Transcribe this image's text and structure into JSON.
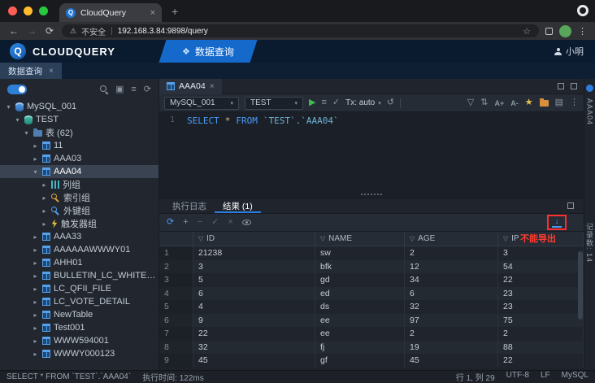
{
  "colors": {
    "accent": "#2e7de0",
    "nav_blue": "#1569cb",
    "run_green": "#3fb950",
    "star_yellow": "#e8c14b",
    "folder_orange": "#d98f3c",
    "annotation_red": "#ff3b30"
  },
  "icons": {
    "close": "×",
    "plus": "+",
    "minus": "−",
    "back": "←",
    "forward": "→",
    "reload": "⟳",
    "refresh": "⟳",
    "warning": "⚠",
    "star_outline": "☆",
    "star": "★",
    "menu_dots": "⋮",
    "nav_glyph": "❖",
    "caret": "▾",
    "arrow_down": "▾",
    "arrow_right": "▸",
    "filter": "▽",
    "play": "▶",
    "check": "✓",
    "undo": "↺",
    "sort": "⇅",
    "lines": "≡",
    "grid": "▤",
    "box": "▣",
    "font_plus": "A+",
    "font_minus": "A-",
    "download": "↓",
    "x": "×"
  },
  "browser": {
    "tab_title": "CloudQuery",
    "favicon_letter": "Q",
    "security": "不安全",
    "divider": "|",
    "url": "192.168.3.84:9898/query"
  },
  "header": {
    "brand": "CLOUDQUERY",
    "logo_letter": "Q",
    "nav_query": "数据查询",
    "user": "小明"
  },
  "workspace": {
    "tab": "数据查询"
  },
  "sidebar": {
    "tree": [
      {
        "label": "MySQL_001",
        "depth": 0,
        "icon": "db",
        "arrow": "down",
        "selected": false
      },
      {
        "label": "TEST",
        "depth": 1,
        "icon": "schema",
        "arrow": "down",
        "selected": false
      },
      {
        "label": "表 (62)",
        "depth": 2,
        "icon": "folder",
        "arrow": "down",
        "selected": false
      },
      {
        "label": "11",
        "depth": 3,
        "icon": "table",
        "arrow": "right",
        "selected": false
      },
      {
        "label": "AAA03",
        "depth": 3,
        "icon": "table",
        "arrow": "right",
        "selected": false
      },
      {
        "label": "AAA04",
        "depth": 3,
        "icon": "table",
        "arrow": "down",
        "selected": true
      },
      {
        "label": "列组",
        "depth": 4,
        "icon": "cols",
        "arrow": "right",
        "selected": false
      },
      {
        "label": "索引组",
        "depth": 4,
        "icon": "key-amber",
        "arrow": "right",
        "selected": false
      },
      {
        "label": "外键组",
        "depth": 4,
        "icon": "key-blue",
        "arrow": "right",
        "selected": false
      },
      {
        "label": "触发器组",
        "depth": 4,
        "icon": "bolt",
        "arrow": "right",
        "selected": false
      },
      {
        "label": "AAA33",
        "depth": 3,
        "icon": "table",
        "arrow": "right",
        "selected": false
      },
      {
        "label": "AAAAAAWWWY01",
        "depth": 3,
        "icon": "table",
        "arrow": "right",
        "selected": false
      },
      {
        "label": "AHH01",
        "depth": 3,
        "icon": "table",
        "arrow": "right",
        "selected": false
      },
      {
        "label": "BULLETIN_LC_WHITELIST_",
        "depth": 3,
        "icon": "table",
        "arrow": "right",
        "selected": false
      },
      {
        "label": "LC_QFII_FILE",
        "depth": 3,
        "icon": "table",
        "arrow": "right",
        "selected": false
      },
      {
        "label": "LC_VOTE_DETAIL",
        "depth": 3,
        "icon": "table",
        "arrow": "right",
        "selected": false
      },
      {
        "label": "NewTable",
        "depth": 3,
        "icon": "table",
        "arrow": "right",
        "selected": false
      },
      {
        "label": "Test001",
        "depth": 3,
        "icon": "table",
        "arrow": "right",
        "selected": false
      },
      {
        "label": "WWW594001",
        "depth": 3,
        "icon": "table",
        "arrow": "right",
        "selected": false
      },
      {
        "label": "WWWY000123",
        "depth": 3,
        "icon": "table",
        "arrow": "right",
        "selected": false
      }
    ]
  },
  "editor": {
    "tab": "AAA04",
    "conn": "MySQL_001",
    "db": "TEST",
    "tx": "Tx: auto",
    "line": "1",
    "sql": {
      "kw1": "SELECT",
      "star": "*",
      "kw2": "FROM",
      "ident": "`TEST`.`AAA04`"
    }
  },
  "results": {
    "tab_log": "执行日志",
    "tab_result": "结果 (1)",
    "annotation": "不能导出",
    "columns": [
      "ID",
      "NAME",
      "AGE",
      "IP"
    ],
    "rows": [
      [
        "1",
        "21238",
        "sw",
        "2",
        "3"
      ],
      [
        "2",
        "3",
        "bfk",
        "12",
        "54"
      ],
      [
        "3",
        "5",
        "gd",
        "34",
        "22"
      ],
      [
        "4",
        "6",
        "ed",
        "6",
        "23"
      ],
      [
        "5",
        "4",
        "ds",
        "32",
        "23"
      ],
      [
        "6",
        "9",
        "ee",
        "97",
        "75"
      ],
      [
        "7",
        "22",
        "ee",
        "2",
        "2"
      ],
      [
        "8",
        "32",
        "fj",
        "19",
        "88"
      ],
      [
        "9",
        "45",
        "gf",
        "45",
        "22"
      ]
    ]
  },
  "rail": {
    "top": "AAA04",
    "mid": "记录数: 14"
  },
  "status": {
    "sql": "SELECT * FROM `TEST`.`AAA04`",
    "time": "执行时间: 122ms",
    "pos": "行 1, 列 29",
    "enc": "UTF-8",
    "eol": "LF",
    "db": "MySQL"
  }
}
